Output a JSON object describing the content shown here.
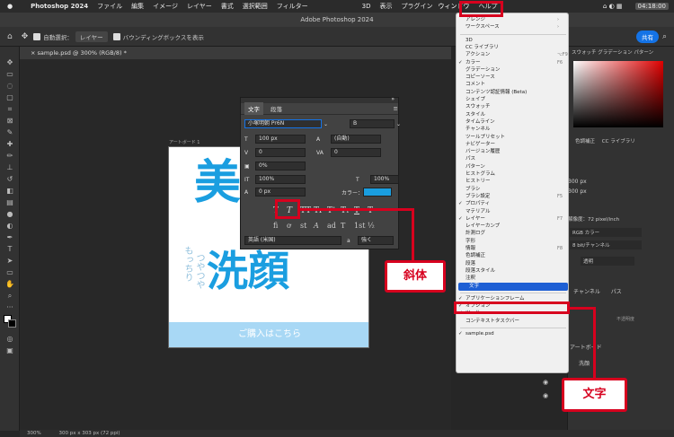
{
  "menubar": {
    "app": "Photoshop 2024",
    "items": [
      "ファイル",
      "編集",
      "イメージ",
      "レイヤー",
      "書式",
      "選択範囲",
      "フィルター",
      "3D",
      "表示",
      "プラグイン",
      "ウィンドウ",
      "ヘルプ"
    ],
    "clock": "04:18:00"
  },
  "window_title": "Adobe Photoshop 2024",
  "options": {
    "auto_select": "自動選択：",
    "layer": "レイヤー",
    "bbox": "バウンディングボックスを表示",
    "share": "共有"
  },
  "doc_tab": "sample.psd @ 300% (RGB/8) *",
  "status": {
    "zoom": "300%",
    "size": "300 px x 303 px (72 ppi)"
  },
  "artboard": {
    "label": "アートボード 1",
    "big1": "美",
    "big2": "洗顔",
    "vert1": "もっちり",
    "vert2": "つやつや",
    "cta": "ご購入はこちら"
  },
  "char_panel": {
    "tab_char": "文字",
    "tab_para": "段落",
    "font": "小塚明朝 Pr6N",
    "style": "B",
    "size": "100 px",
    "leading": "(自動)",
    "kern": "0",
    "track": "0",
    "tsume": "0%",
    "vscale": "100%",
    "hscale": "100%",
    "baseline": "0 px",
    "color_label": "カラー：",
    "lang": "英語 (米国)",
    "aa": "強く",
    "styles": [
      "T",
      "T",
      "TT",
      "Tr",
      "T¹",
      "T₁",
      "T",
      "T"
    ],
    "opentype": [
      "fi",
      "ơ",
      "st",
      "A",
      "ad",
      "T",
      "1st",
      "½"
    ]
  },
  "menu": {
    "items": [
      {
        "label": "アレンジ",
        "arrow": "›"
      },
      {
        "label": "ワークスペース",
        "arrow": "›"
      },
      {
        "sep": true
      },
      {
        "label": "3D"
      },
      {
        "label": "CC ライブラリ"
      },
      {
        "label": "アクション",
        "shortcut": "⌥F9"
      },
      {
        "label": "カラー",
        "check": true,
        "shortcut": "F6"
      },
      {
        "label": "グラデーション"
      },
      {
        "label": "コピーソース"
      },
      {
        "label": "コメント"
      },
      {
        "label": "コンテンツ認証情報 (Beta)"
      },
      {
        "label": "シェイプ"
      },
      {
        "label": "スウォッチ"
      },
      {
        "label": "スタイル"
      },
      {
        "label": "タイムライン"
      },
      {
        "label": "チャンネル"
      },
      {
        "label": "ツールプリセット"
      },
      {
        "label": "ナビゲーター"
      },
      {
        "label": "バージョン履歴"
      },
      {
        "label": "パス"
      },
      {
        "label": "パターン"
      },
      {
        "label": "ヒストグラム"
      },
      {
        "label": "ヒストリー"
      },
      {
        "label": "ブラシ"
      },
      {
        "label": "ブラシ設定",
        "shortcut": "F5"
      },
      {
        "label": "プロパティ",
        "check": true
      },
      {
        "label": "マテリアル"
      },
      {
        "label": "レイヤー",
        "check": true,
        "shortcut": "F7"
      },
      {
        "label": "レイヤーカンプ"
      },
      {
        "label": "計測ログ"
      },
      {
        "label": "字形"
      },
      {
        "label": "情報",
        "shortcut": "F8"
      },
      {
        "label": "色調補正"
      },
      {
        "label": "段落"
      },
      {
        "label": "段落スタイル"
      },
      {
        "label": "注釈"
      },
      {
        "label": "文字",
        "highlight": true
      },
      {
        "sep": true
      },
      {
        "label": "アプリケーションフレーム",
        "check": true
      },
      {
        "label": "オプション",
        "check": true
      },
      {
        "label": "ツール",
        "check": true
      },
      {
        "label": "コンテキストタスクバー"
      },
      {
        "sep": true
      },
      {
        "label": "sample.psd",
        "check": true
      }
    ]
  },
  "right_panel": {
    "tabs": [
      "スウォッチ",
      "グラデーション",
      "パターン"
    ],
    "tabs2": [
      "色調補正",
      "CC ライブラリ"
    ],
    "w": "300 px",
    "h": "300 px",
    "res": "解像度：72 pixel/inch",
    "mode": "RGB カラー",
    "depth": "8 bit/チャンネル",
    "bg": "透明",
    "layer_tabs": [
      "チャンネル",
      "パス"
    ],
    "opacity_lbl": "不透明度",
    "artboard": "アートボード",
    "layer": "洗顔"
  },
  "callouts": {
    "italic": "斜体",
    "char": "文字"
  },
  "colors": {
    "accent": "#d7001e",
    "highlight": "#1e5fd4",
    "brand_blue": "#1a9ee0",
    "swatch": "#1a9ee0"
  }
}
